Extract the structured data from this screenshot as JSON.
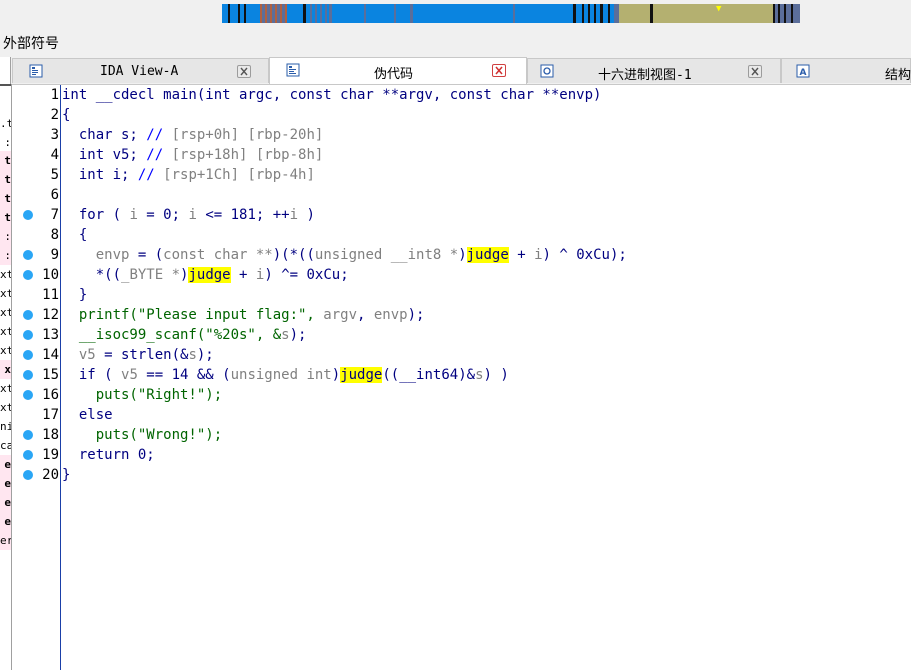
{
  "toolbar": {
    "label": "外部符号"
  },
  "tabs": [
    {
      "label": "IDA View-A",
      "icon": "graph-view-icon",
      "active": false,
      "closable": true
    },
    {
      "label": "伪代码",
      "icon": "pseudocode-icon",
      "active": true,
      "closable": true
    },
    {
      "label": "十六进制视图-1",
      "icon": "hex-view-icon",
      "active": false,
      "closable": true
    },
    {
      "label": "结构",
      "icon": "structures-icon",
      "active": false,
      "closable": false
    }
  ],
  "left_panel_fragments": [
    "",
    ".t",
    ":",
    "t",
    "t",
    "t",
    "t",
    ":",
    ":",
    "xt",
    "xt",
    "xt",
    "xt",
    "xt",
    "x",
    "xt",
    "xt",
    "ni",
    "ca",
    "e",
    "e",
    "e",
    "e",
    "er"
  ],
  "colors": {
    "accent_breakpoint": "#2aa6f5",
    "highlight": "#ffff00",
    "keyword": "#000080",
    "variable": "#808080",
    "comment": "#0000ff"
  },
  "code": {
    "lines": [
      {
        "n": "1",
        "bp": false,
        "text": "int __cdecl main(int argc, const char **argv, const char **envp)"
      },
      {
        "n": "2",
        "bp": false,
        "text": "{"
      },
      {
        "n": "3",
        "bp": false,
        "text": "  char s; // [rsp+0h] [rbp-20h]"
      },
      {
        "n": "4",
        "bp": false,
        "text": "  int v5; // [rsp+18h] [rbp-8h]"
      },
      {
        "n": "5",
        "bp": false,
        "text": "  int i; // [rsp+1Ch] [rbp-4h]"
      },
      {
        "n": "6",
        "bp": false,
        "text": ""
      },
      {
        "n": "7",
        "bp": true,
        "text": "  for ( i = 0; i <= 181; ++i )"
      },
      {
        "n": "8",
        "bp": false,
        "text": "  {"
      },
      {
        "n": "9",
        "bp": true,
        "text": "    envp = (const char **)(*((unsigned __int8 *)judge + i) ^ 0xCu);"
      },
      {
        "n": "10",
        "bp": true,
        "text": "    *((_BYTE *)judge + i) ^= 0xCu;"
      },
      {
        "n": "11",
        "bp": false,
        "text": "  }"
      },
      {
        "n": "12",
        "bp": true,
        "text": "  printf(\"Please input flag:\", argv, envp);"
      },
      {
        "n": "13",
        "bp": true,
        "text": "  __isoc99_scanf(\"%20s\", &s);"
      },
      {
        "n": "14",
        "bp": true,
        "text": "  v5 = strlen(&s);"
      },
      {
        "n": "15",
        "bp": true,
        "text": "  if ( v5 == 14 && (unsigned int)judge((__int64)&s) )"
      },
      {
        "n": "16",
        "bp": true,
        "text": "    puts(\"Right!\");"
      },
      {
        "n": "17",
        "bp": false,
        "text": "  else"
      },
      {
        "n": "18",
        "bp": true,
        "text": "    puts(\"Wrong!\");"
      },
      {
        "n": "19",
        "bp": true,
        "text": "  return 0;"
      },
      {
        "n": "20",
        "bp": true,
        "text": "}"
      }
    ],
    "tokens": {
      "l1": "int __cdecl main(int argc, const char **argv, const char **envp)",
      "l2": "{",
      "l3a": "  char s; ",
      "l3b": "// ",
      "l3c": "[rsp+0h] [rbp-20h]",
      "l4a": "  int v5; ",
      "l4b": "// ",
      "l4c": "[rsp+18h] [rbp-8h]",
      "l5a": "  int i; ",
      "l5b": "// ",
      "l5c": "[rsp+1Ch] [rbp-4h]",
      "l7a": "  for ( ",
      "l7b": "i",
      "l7c": " = 0; ",
      "l7d": "i",
      "l7e": " <= 181; ++",
      "l7f": "i",
      "l7g": " )",
      "l8": "  {",
      "l9a": "    ",
      "l9b": "envp",
      "l9c": " = (",
      "l9d": "const char **",
      "l9e": ")(*((",
      "l9f": "unsigned __int8 *",
      "l9g": ")",
      "l9h": "judge",
      "l9i": " + ",
      "l9j": "i",
      "l9k": ") ^ 0xCu);",
      "l10a": "    *((",
      "l10b": "_BYTE *",
      "l10c": ")",
      "l10d": "judge",
      "l10e": " + ",
      "l10f": "i",
      "l10g": ") ^= 0xCu;",
      "l11": "  }",
      "l12a": "  printf(\"Please input flag:\", ",
      "l12b": "argv",
      "l12c": ", ",
      "l12d": "envp",
      "l12e": ");",
      "l13a": "  __isoc99_scanf(\"%20s\", &",
      "l13b": "s",
      "l13c": ");",
      "l14a": "  ",
      "l14b": "v5",
      "l14c": " = strlen(&",
      "l14d": "s",
      "l14e": ");",
      "l15a": "  if ( ",
      "l15b": "v5",
      "l15c": " == 14 && (",
      "l15d": "unsigned int",
      "l15e": ")",
      "l15f": "judge",
      "l15g": "((__int64)&",
      "l15h": "s",
      "l15i": ") )",
      "l16": "    puts(\"Right!\");",
      "l17": "  else",
      "l18": "    puts(\"Wrong!\");",
      "l19": "  return 0;",
      "l20": "}"
    }
  }
}
